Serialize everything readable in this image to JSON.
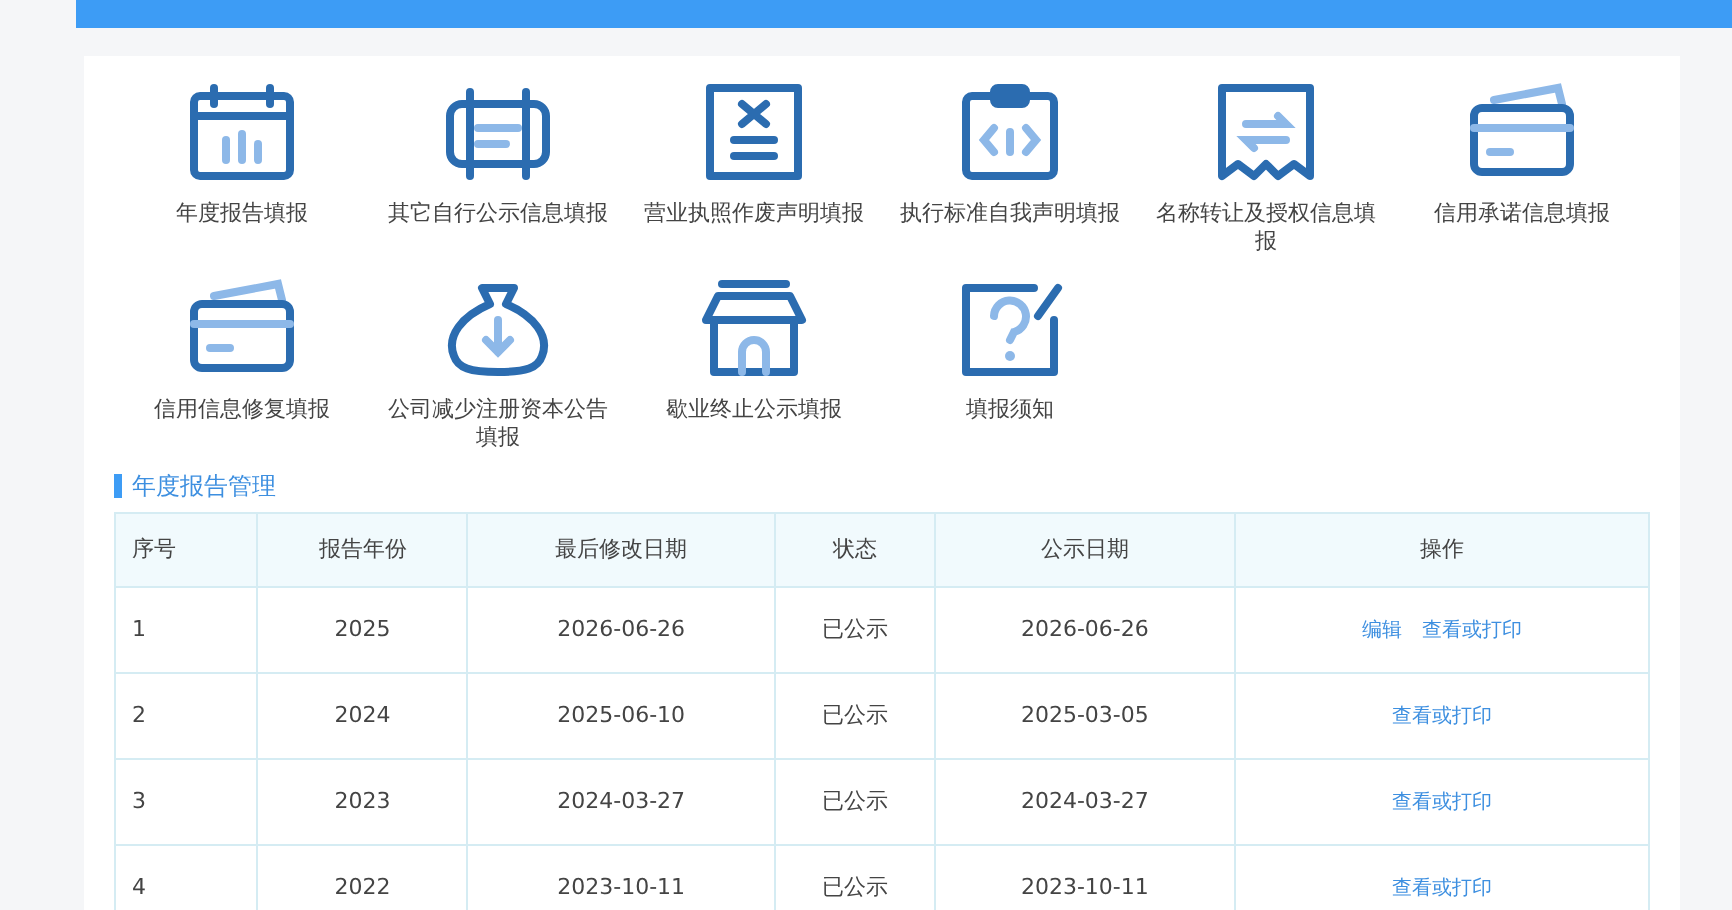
{
  "tiles": [
    {
      "kind": "calendar",
      "label": "年度报告填报"
    },
    {
      "kind": "notice",
      "label": "其它自行公示信息填报"
    },
    {
      "kind": "license",
      "label": "营业执照作废声明填报"
    },
    {
      "kind": "clipboard",
      "label": "执行标准自我声明填报"
    },
    {
      "kind": "transfer",
      "label": "名称转让及授权信息填报"
    },
    {
      "kind": "card",
      "label": "信用承诺信息填报"
    },
    {
      "kind": "card",
      "label": "信用信息修复填报"
    },
    {
      "kind": "bag",
      "label": "公司减少注册资本公告填报"
    },
    {
      "kind": "shop",
      "label": "歇业终止公示填报"
    },
    {
      "kind": "help",
      "label": "填报须知"
    }
  ],
  "section_title": "年度报告管理",
  "table": {
    "columns": [
      "序号",
      "报告年份",
      "最后修改日期",
      "状态",
      "公示日期",
      "操作"
    ],
    "rows": [
      {
        "cells": [
          "1",
          "2025",
          "2026-06-26",
          "已公示",
          "2026-06-26"
        ],
        "actions": [
          "编辑",
          "查看或打印"
        ]
      },
      {
        "cells": [
          "2",
          "2024",
          "2025-06-10",
          "已公示",
          "2025-03-05"
        ],
        "actions": [
          "查看或打印"
        ]
      },
      {
        "cells": [
          "3",
          "2023",
          "2024-03-27",
          "已公示",
          "2024-03-27"
        ],
        "actions": [
          "查看或打印"
        ]
      },
      {
        "cells": [
          "4",
          "2022",
          "2023-10-11",
          "已公示",
          "2023-10-11"
        ],
        "actions": [
          "查看或打印"
        ]
      }
    ]
  }
}
